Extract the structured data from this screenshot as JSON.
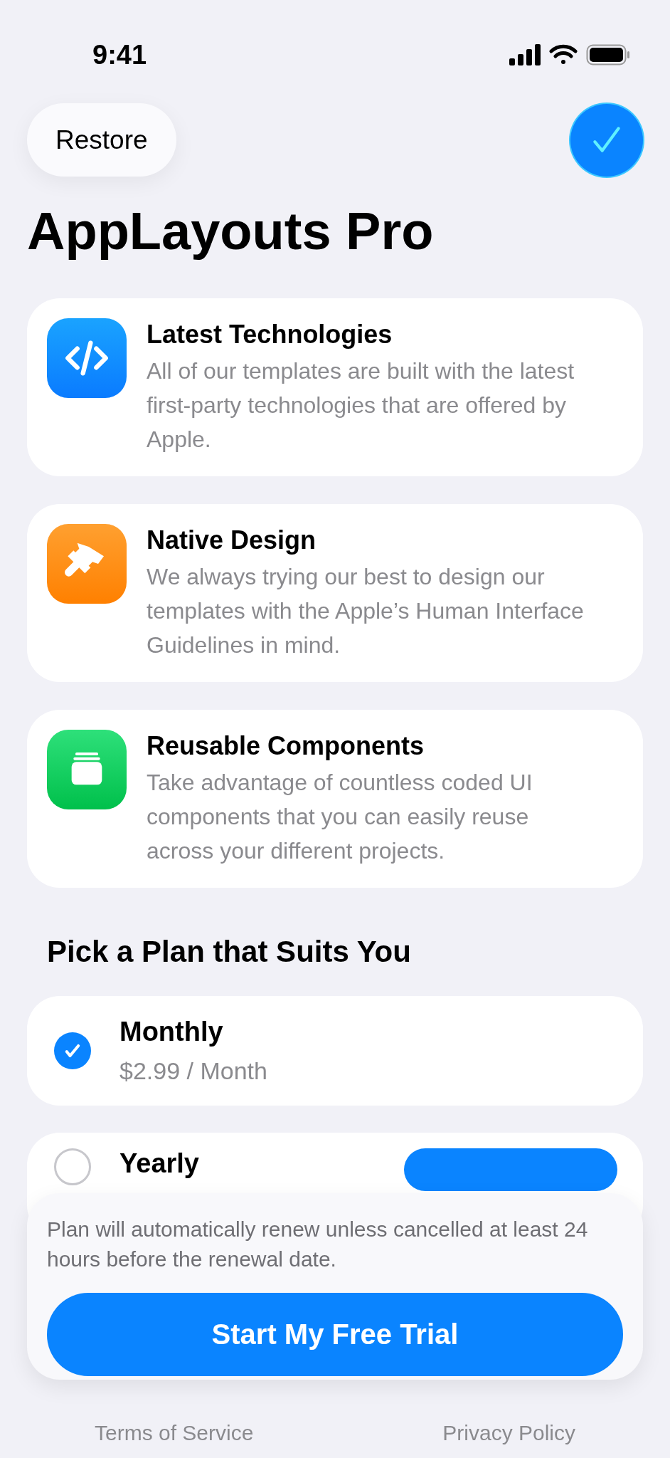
{
  "status_bar": {
    "time": "9:41"
  },
  "header": {
    "restore": "Restore",
    "done_checked": true
  },
  "title": "AppLayouts Pro",
  "features": [
    {
      "kind": "code",
      "title": "Latest Technologies",
      "description": "All of our templates are built with the latest first-party technologies that are offered by Apple."
    },
    {
      "kind": "brush",
      "title": "Native Design",
      "description": "We always trying our best to design our templates with the Apple’s Human Interface Guidelines in mind."
    },
    {
      "kind": "stack",
      "title": "Reusable Components",
      "description": "Take advantage of countless coded UI components that you can easily reuse across your different projects."
    }
  ],
  "plans_heading": "Pick a Plan that Suits You",
  "plans": [
    {
      "name": "Monthly",
      "price": "$2.99 / Month",
      "selected": true
    },
    {
      "name": "Yearly",
      "selected": false
    }
  ],
  "sheet": {
    "note": "Plan will automatically renew unless cancelled at least 24 hours before the renewal date.",
    "button": "Start My Free Trial"
  },
  "footer": {
    "links": [
      "Terms of Service",
      "Privacy Policy"
    ]
  }
}
